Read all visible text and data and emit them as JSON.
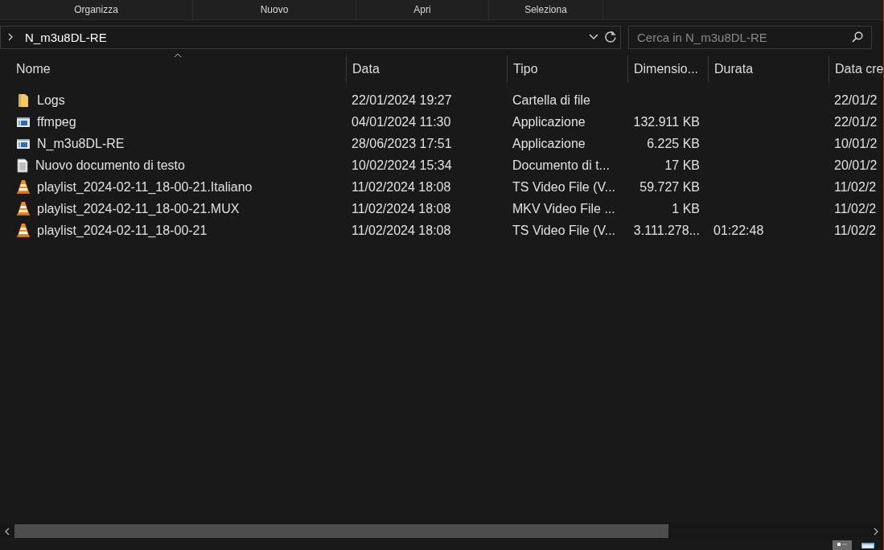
{
  "toolbar": {
    "groups": [
      "Organizza",
      "Nuovo",
      "Apri",
      "Seleziona"
    ]
  },
  "address": {
    "path": "N_m3u8DL-RE"
  },
  "search": {
    "placeholder": "Cerca in N_m3u8DL-RE"
  },
  "table": {
    "columns": [
      "Nome",
      "Data",
      "Tipo",
      "Dimensio...",
      "Durata",
      "Data cre"
    ],
    "rows": [
      {
        "kind": "folder",
        "name": "Logs",
        "date": "22/01/2024 19:27",
        "type": "Cartella di file",
        "size": "",
        "duration": "",
        "created": "22/01/2"
      },
      {
        "kind": "application",
        "name": "ffmpeg",
        "date": "04/01/2024 11:30",
        "type": "Applicazione",
        "size": "132.911 KB",
        "duration": "",
        "created": "22/01/2"
      },
      {
        "kind": "application",
        "name": "N_m3u8DL-RE",
        "date": "28/06/2023 17:51",
        "type": "Applicazione",
        "size": "6.225 KB",
        "duration": "",
        "created": "10/01/2"
      },
      {
        "kind": "text",
        "name": "Nuovo documento di testo",
        "date": "10/02/2024 15:34",
        "type": "Documento di t...",
        "size": "17 KB",
        "duration": "",
        "created": "20/01/2"
      },
      {
        "kind": "video",
        "name": "playlist_2024-02-11_18-00-21.Italiano",
        "date": "11/02/2024 18:08",
        "type": "TS Video File (V...",
        "size": "59.727 KB",
        "duration": "",
        "created": "11/02/2"
      },
      {
        "kind": "video",
        "name": "playlist_2024-02-11_18-00-21.MUX",
        "date": "11/02/2024 18:08",
        "type": "MKV Video File ...",
        "size": "1 KB",
        "duration": "",
        "created": "11/02/2"
      },
      {
        "kind": "video",
        "name": "playlist_2024-02-11_18-00-21",
        "date": "11/02/2024 18:08",
        "type": "TS Video File (V...",
        "size": "3.111.278...",
        "duration": "01:22:48",
        "created": "11/02/2"
      }
    ]
  },
  "view_buttons": [
    {
      "kind": "details",
      "selected": true
    },
    {
      "kind": "tiles",
      "selected": false
    }
  ]
}
